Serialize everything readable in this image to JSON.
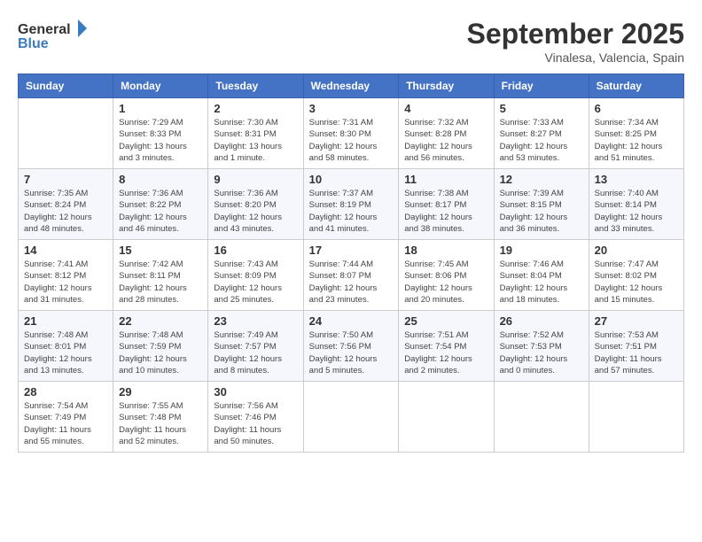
{
  "header": {
    "logo_general": "General",
    "logo_blue": "Blue",
    "month": "September 2025",
    "location": "Vinalesa, Valencia, Spain"
  },
  "days_of_week": [
    "Sunday",
    "Monday",
    "Tuesday",
    "Wednesday",
    "Thursday",
    "Friday",
    "Saturday"
  ],
  "weeks": [
    [
      {
        "day": "",
        "info": ""
      },
      {
        "day": "1",
        "info": "Sunrise: 7:29 AM\nSunset: 8:33 PM\nDaylight: 13 hours\nand 3 minutes."
      },
      {
        "day": "2",
        "info": "Sunrise: 7:30 AM\nSunset: 8:31 PM\nDaylight: 13 hours\nand 1 minute."
      },
      {
        "day": "3",
        "info": "Sunrise: 7:31 AM\nSunset: 8:30 PM\nDaylight: 12 hours\nand 58 minutes."
      },
      {
        "day": "4",
        "info": "Sunrise: 7:32 AM\nSunset: 8:28 PM\nDaylight: 12 hours\nand 56 minutes."
      },
      {
        "day": "5",
        "info": "Sunrise: 7:33 AM\nSunset: 8:27 PM\nDaylight: 12 hours\nand 53 minutes."
      },
      {
        "day": "6",
        "info": "Sunrise: 7:34 AM\nSunset: 8:25 PM\nDaylight: 12 hours\nand 51 minutes."
      }
    ],
    [
      {
        "day": "7",
        "info": "Sunrise: 7:35 AM\nSunset: 8:24 PM\nDaylight: 12 hours\nand 48 minutes."
      },
      {
        "day": "8",
        "info": "Sunrise: 7:36 AM\nSunset: 8:22 PM\nDaylight: 12 hours\nand 46 minutes."
      },
      {
        "day": "9",
        "info": "Sunrise: 7:36 AM\nSunset: 8:20 PM\nDaylight: 12 hours\nand 43 minutes."
      },
      {
        "day": "10",
        "info": "Sunrise: 7:37 AM\nSunset: 8:19 PM\nDaylight: 12 hours\nand 41 minutes."
      },
      {
        "day": "11",
        "info": "Sunrise: 7:38 AM\nSunset: 8:17 PM\nDaylight: 12 hours\nand 38 minutes."
      },
      {
        "day": "12",
        "info": "Sunrise: 7:39 AM\nSunset: 8:15 PM\nDaylight: 12 hours\nand 36 minutes."
      },
      {
        "day": "13",
        "info": "Sunrise: 7:40 AM\nSunset: 8:14 PM\nDaylight: 12 hours\nand 33 minutes."
      }
    ],
    [
      {
        "day": "14",
        "info": "Sunrise: 7:41 AM\nSunset: 8:12 PM\nDaylight: 12 hours\nand 31 minutes."
      },
      {
        "day": "15",
        "info": "Sunrise: 7:42 AM\nSunset: 8:11 PM\nDaylight: 12 hours\nand 28 minutes."
      },
      {
        "day": "16",
        "info": "Sunrise: 7:43 AM\nSunset: 8:09 PM\nDaylight: 12 hours\nand 25 minutes."
      },
      {
        "day": "17",
        "info": "Sunrise: 7:44 AM\nSunset: 8:07 PM\nDaylight: 12 hours\nand 23 minutes."
      },
      {
        "day": "18",
        "info": "Sunrise: 7:45 AM\nSunset: 8:06 PM\nDaylight: 12 hours\nand 20 minutes."
      },
      {
        "day": "19",
        "info": "Sunrise: 7:46 AM\nSunset: 8:04 PM\nDaylight: 12 hours\nand 18 minutes."
      },
      {
        "day": "20",
        "info": "Sunrise: 7:47 AM\nSunset: 8:02 PM\nDaylight: 12 hours\nand 15 minutes."
      }
    ],
    [
      {
        "day": "21",
        "info": "Sunrise: 7:48 AM\nSunset: 8:01 PM\nDaylight: 12 hours\nand 13 minutes."
      },
      {
        "day": "22",
        "info": "Sunrise: 7:48 AM\nSunset: 7:59 PM\nDaylight: 12 hours\nand 10 minutes."
      },
      {
        "day": "23",
        "info": "Sunrise: 7:49 AM\nSunset: 7:57 PM\nDaylight: 12 hours\nand 8 minutes."
      },
      {
        "day": "24",
        "info": "Sunrise: 7:50 AM\nSunset: 7:56 PM\nDaylight: 12 hours\nand 5 minutes."
      },
      {
        "day": "25",
        "info": "Sunrise: 7:51 AM\nSunset: 7:54 PM\nDaylight: 12 hours\nand 2 minutes."
      },
      {
        "day": "26",
        "info": "Sunrise: 7:52 AM\nSunset: 7:53 PM\nDaylight: 12 hours\nand 0 minutes."
      },
      {
        "day": "27",
        "info": "Sunrise: 7:53 AM\nSunset: 7:51 PM\nDaylight: 11 hours\nand 57 minutes."
      }
    ],
    [
      {
        "day": "28",
        "info": "Sunrise: 7:54 AM\nSunset: 7:49 PM\nDaylight: 11 hours\nand 55 minutes."
      },
      {
        "day": "29",
        "info": "Sunrise: 7:55 AM\nSunset: 7:48 PM\nDaylight: 11 hours\nand 52 minutes."
      },
      {
        "day": "30",
        "info": "Sunrise: 7:56 AM\nSunset: 7:46 PM\nDaylight: 11 hours\nand 50 minutes."
      },
      {
        "day": "",
        "info": ""
      },
      {
        "day": "",
        "info": ""
      },
      {
        "day": "",
        "info": ""
      },
      {
        "day": "",
        "info": ""
      }
    ]
  ]
}
